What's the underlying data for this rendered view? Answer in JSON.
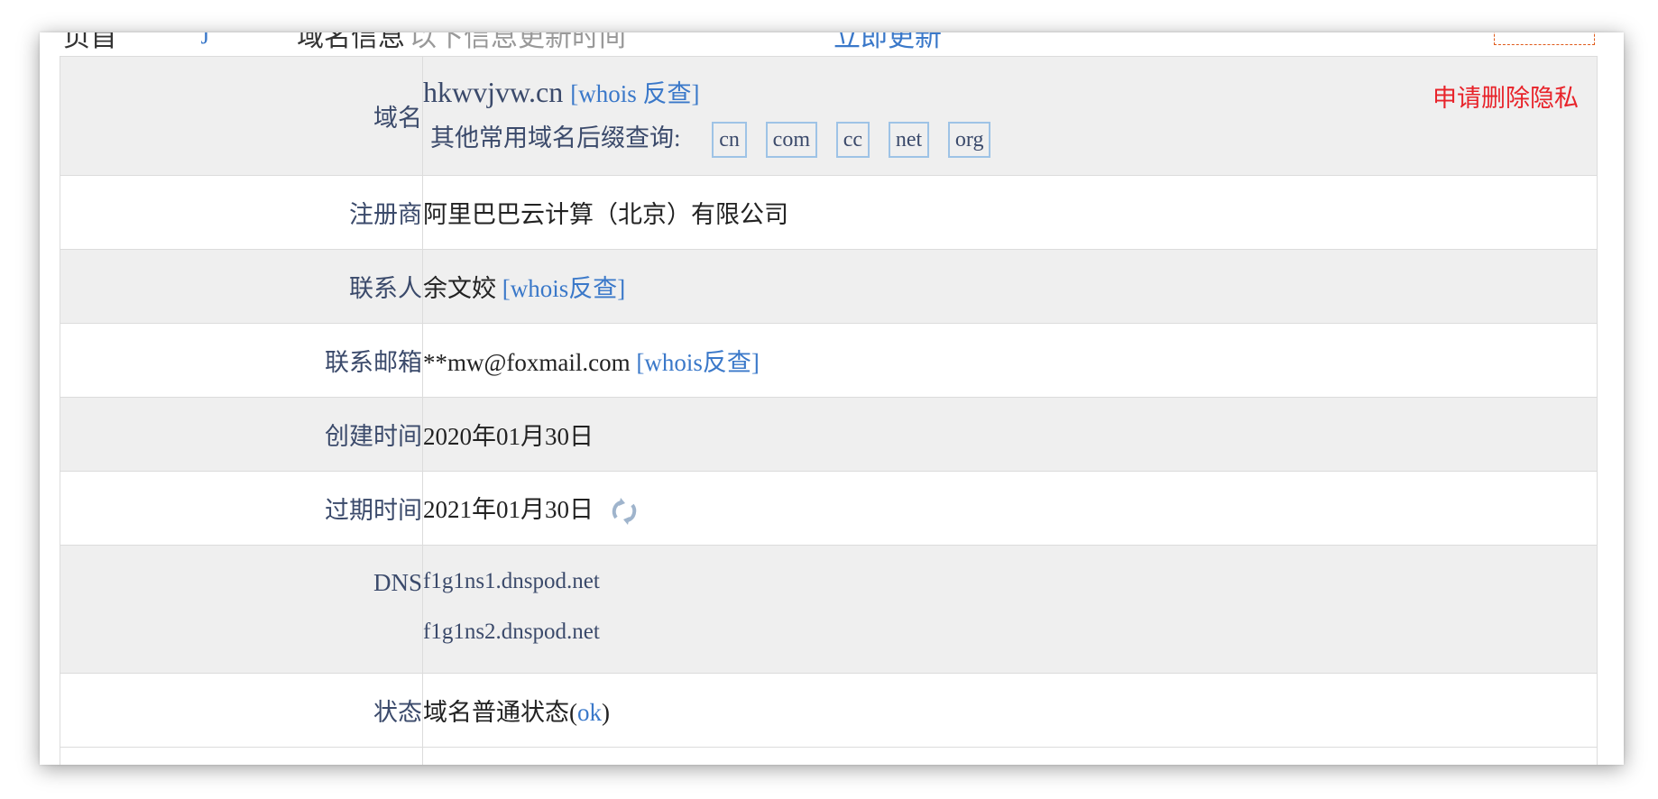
{
  "top_partial": {
    "item1": "页首",
    "item2": "j",
    "item3": "域名信息",
    "item4": "以下信息更新时间",
    "item5": "立即更新"
  },
  "domain": {
    "label": "域名",
    "name": "hkwvjvw.cn",
    "whois_link": "[whois 反查]",
    "suffix_prompt": "其他常用域名后缀查询:",
    "suffixes": [
      "cn",
      "com",
      "cc",
      "net",
      "org"
    ],
    "privacy_link": "申请删除隐私"
  },
  "registrar": {
    "label": "注册商",
    "value": "阿里巴巴云计算（北京）有限公司"
  },
  "contact": {
    "label": "联系人",
    "value": "余文姣",
    "whois_link": "[whois反查]"
  },
  "email": {
    "label": "联系邮箱",
    "value": "**mw@foxmail.com",
    "whois_link": "[whois反查]"
  },
  "created": {
    "label": "创建时间",
    "value": "2020年01月30日"
  },
  "expires": {
    "label": "过期时间",
    "value": "2021年01月30日"
  },
  "dns": {
    "label": "DNS",
    "servers": [
      "f1g1ns1.dnspod.net",
      "f1g1ns2.dnspod.net"
    ]
  },
  "status": {
    "label": "状态",
    "value": "域名普通状态(",
    "code": "ok",
    "close": ")"
  },
  "colors": {
    "link": "#3a78c9",
    "label": "#3b4a6b",
    "privacy": "#e8232a",
    "row_gray": "#efefef"
  },
  "icons": {
    "refresh": "refresh-icon"
  }
}
